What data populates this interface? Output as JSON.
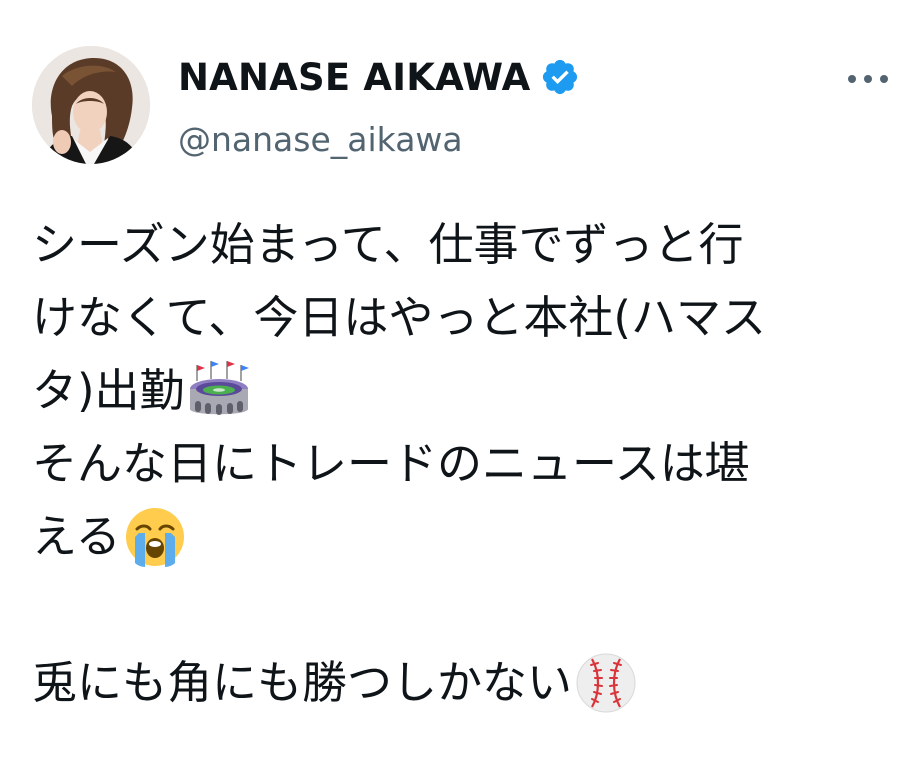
{
  "author": {
    "display_name": "NANASE AIKAWA",
    "handle": "@nanase_aikawa",
    "verified": true
  },
  "more_menu": {
    "icon": "more-horizontal-icon"
  },
  "tweet_lines": [
    "シーズン始まって、仕事でずっと行",
    "けなくて、今日はやっと本社(ハマス",
    "タ)出勤",
    "そんな日にトレードのニュースは堪",
    "える",
    "",
    "兎にも角にも勝つしかない"
  ],
  "emojis": {
    "line3": "stadium-emoji",
    "line5": "loudly-crying-face-emoji",
    "line7": "baseball-emoji"
  },
  "colors": {
    "text": "#0f1419",
    "secondary": "#536471",
    "verified_blue": "#1d9bf0"
  }
}
